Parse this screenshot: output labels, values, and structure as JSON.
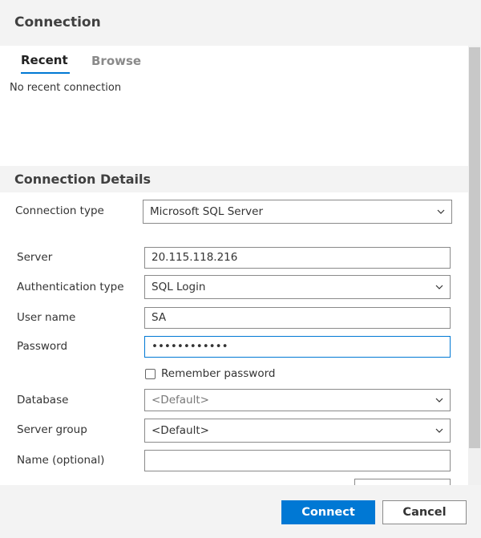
{
  "dialog": {
    "title": "Connection"
  },
  "tabs": [
    {
      "label": "Recent",
      "active": true
    },
    {
      "label": "Browse",
      "active": false
    }
  ],
  "recent": {
    "empty_text": "No recent connection"
  },
  "details": {
    "heading": "Connection Details",
    "connection_type": {
      "label": "Connection type",
      "value": "Microsoft SQL Server"
    },
    "server": {
      "label": "Server",
      "value": "20.115.118.216"
    },
    "auth_type": {
      "label": "Authentication type",
      "value": "SQL Login"
    },
    "user_name": {
      "label": "User name",
      "value": "SA"
    },
    "password": {
      "label": "Password",
      "value": "••••••••••••"
    },
    "remember_password": {
      "label": "Remember password",
      "checked": false
    },
    "database": {
      "label": "Database",
      "value": "<Default>"
    },
    "server_group": {
      "label": "Server group",
      "value": "<Default>"
    },
    "name_optional": {
      "label": "Name (optional)",
      "value": ""
    }
  },
  "footer": {
    "connect_label": "Connect",
    "cancel_label": "Cancel"
  },
  "colors": {
    "accent": "#0078d4",
    "header_bg": "#f3f3f3"
  }
}
